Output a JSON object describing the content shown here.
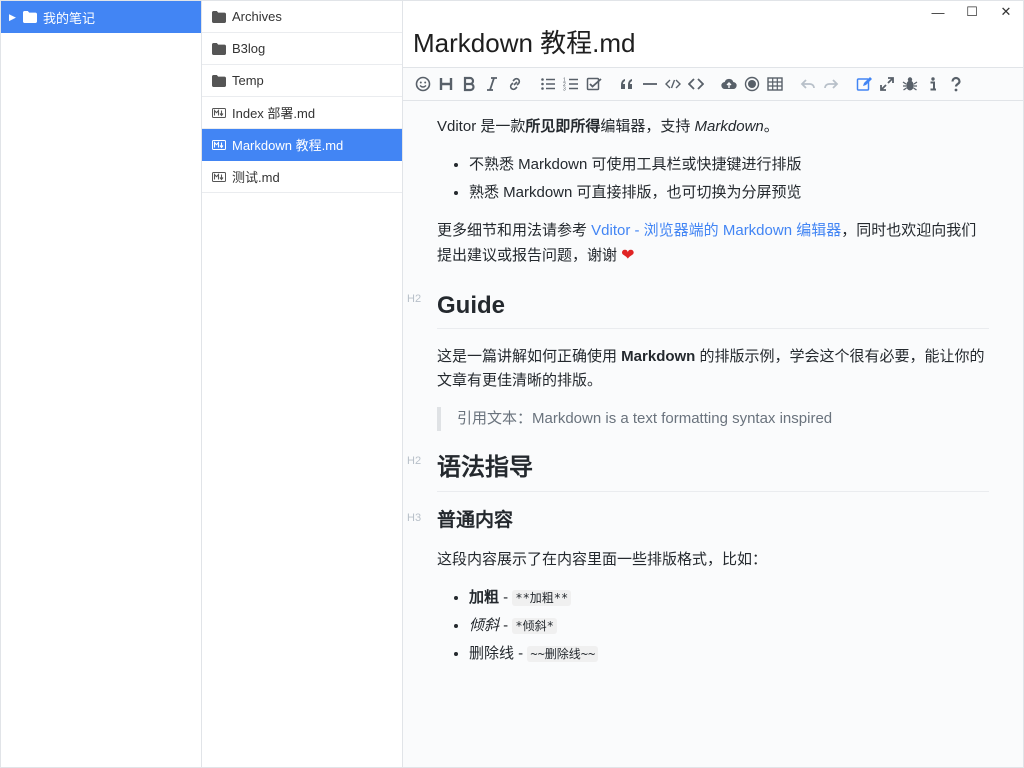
{
  "tree": {
    "root": "我的笔记"
  },
  "files": [
    {
      "name": "Archives",
      "type": "folder"
    },
    {
      "name": "B3log",
      "type": "folder"
    },
    {
      "name": "Temp",
      "type": "folder"
    },
    {
      "name": "Index 部署.md",
      "type": "md"
    },
    {
      "name": "Markdown 教程.md",
      "type": "md",
      "selected": true
    },
    {
      "name": "测试.md",
      "type": "md"
    }
  ],
  "editor": {
    "title": "Markdown 教程.md",
    "window": {
      "minimize": "—",
      "maximize": "☐",
      "close": "✕"
    }
  },
  "toolbar_icons": [
    "emoji-icon",
    "heading-icon",
    "bold-icon",
    "italic-icon",
    "link-icon",
    "list-icon",
    "ordered-list-icon",
    "check-icon",
    "quote-icon",
    "line-icon",
    "inline-code-icon",
    "code-icon",
    "upload-icon",
    "record-icon",
    "table-icon",
    "undo-icon",
    "redo-icon",
    "edit-mode-icon",
    "fullscreen-icon",
    "devtools-icon",
    "info-icon",
    "help-icon"
  ],
  "colors": {
    "accent": "#4285f4",
    "muted": "#b8c0c9"
  },
  "doc": {
    "intro": {
      "a": "Vditor 是一款",
      "b": "所见即所得",
      "c": "编辑器，支持 ",
      "d": "Markdown",
      "e": "。"
    },
    "features": [
      "不熟悉 Markdown 可使用工具栏或快捷键进行排版",
      "熟悉 Markdown 可直接排版，也可切换为分屏预览"
    ],
    "more": {
      "a": "更多细节和用法请参考 ",
      "link": "Vditor - 浏览器端的 Markdown 编辑器",
      "b": "，同时也欢迎向我们提出建议或报告问题，谢谢 "
    },
    "h_guide": "Guide",
    "h_mark": "H2",
    "guide_text": {
      "a": "这是一篇讲解如何正确使用 ",
      "b": "Markdown",
      "c": " 的排版示例，学会这个很有必要，能让你的文章有更佳清晰的排版。"
    },
    "quote": "引用文本：Markdown is a text formatting syntax inspired",
    "h_syntax": "语法指导",
    "h3_mark": "H3",
    "h_normal": "普通内容",
    "normal_text": "这段内容展示了在内容里面一些排版格式，比如：",
    "styles": [
      {
        "label": "加粗",
        "sep": " - ",
        "code": "**加粗**"
      },
      {
        "label": "倾斜",
        "sep": " - ",
        "code": "*倾斜*"
      },
      {
        "label": "删除线",
        "sep": " - ",
        "code": "~~删除线~~"
      }
    ]
  }
}
